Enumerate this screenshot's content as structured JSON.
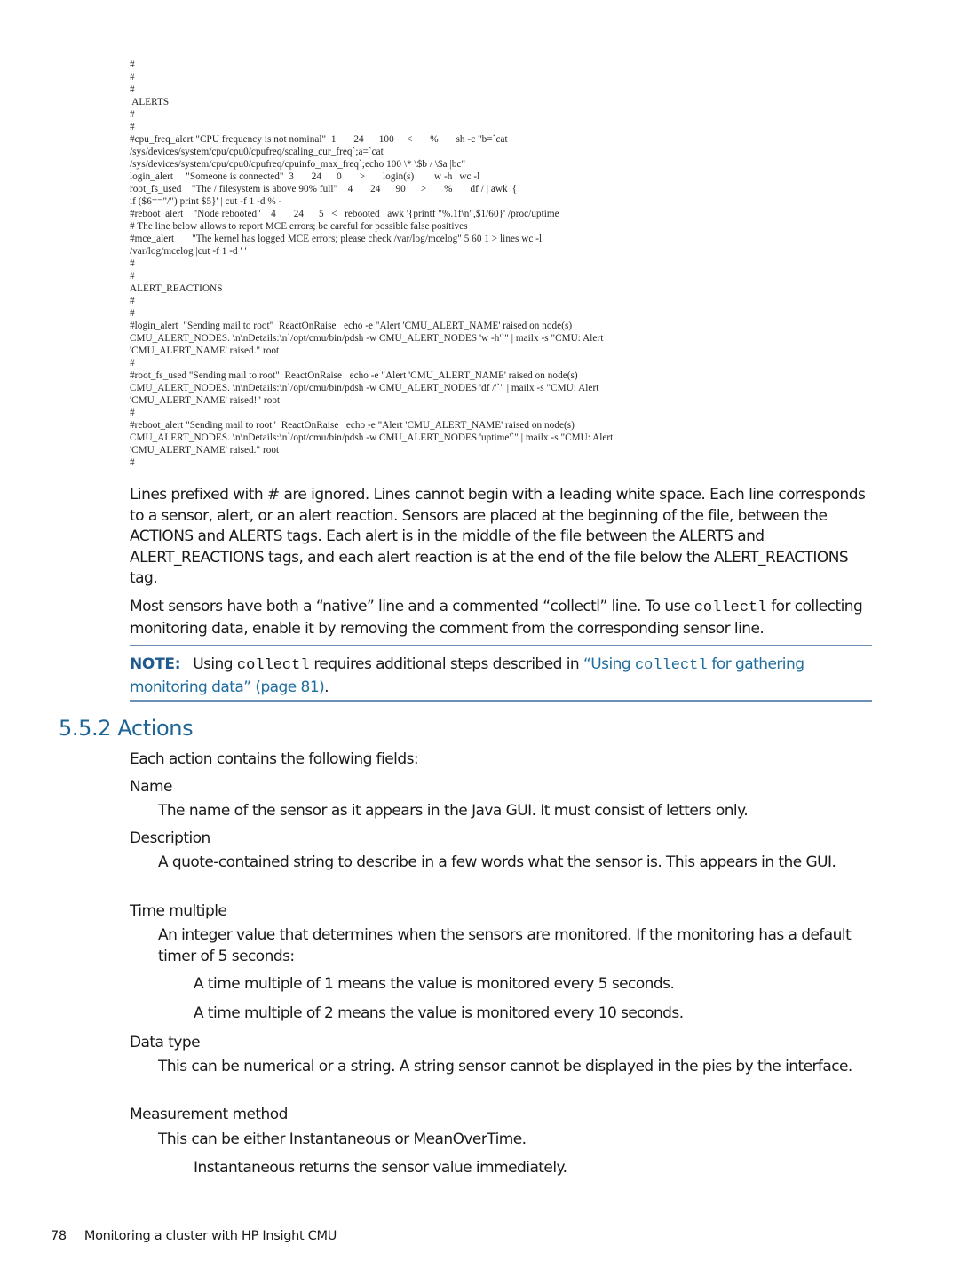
{
  "code_block": {
    "lines": [
      "#",
      "#",
      "#",
      " ALERTS",
      "#",
      "#",
      "#cpu_freq_alert \"CPU frequency is not nominal\"  1       24      100     <       %       sh -c \"b=`cat",
      "/sys/devices/system/cpu/cpu0/cpufreq/scaling_cur_freq`;a=`cat",
      "/sys/devices/system/cpu/cpu0/cpufreq/cpuinfo_max_freq`;echo 100 \\* \\$b / \\$a |bc\"",
      "login_alert     \"Someone is connected\"  3       24      0       >       login(s)        w -h | wc -l",
      "root_fs_used    \"The / filesystem is above 90% full\"    4       24      90      >       %       df / | awk '{",
      "if ($6==\"/\") print $5}' | cut -f 1 -d % -",
      "#reboot_alert    \"Node rebooted\"    4       24      5   <   rebooted   awk '{printf \"%.1f\\n\",$1/60}' /proc/uptime",
      "# The line below allows to report MCE errors; be careful for possible false positives",
      "#mce_alert       \"The kernel has logged MCE errors; please check /var/log/mcelog\" 5 60 1 > lines wc -l",
      "/var/log/mcelog |cut -f 1 -d ' '",
      "#",
      "#",
      "ALERT_REACTIONS",
      "#",
      "#",
      "#login_alert  \"Sending mail to root\"  ReactOnRaise   echo -e \"Alert 'CMU_ALERT_NAME' raised on node(s)",
      "CMU_ALERT_NODES. \\n\\nDetails:\\n`/opt/cmu/bin/pdsh -w CMU_ALERT_NODES 'w -h'`\" | mailx -s \"CMU: Alert",
      "'CMU_ALERT_NAME' raised.\" root",
      "#",
      "#root_fs_used \"Sending mail to root\"  ReactOnRaise   echo -e \"Alert 'CMU_ALERT_NAME' raised on node(s)",
      "CMU_ALERT_NODES. \\n\\nDetails:\\n`/opt/cmu/bin/pdsh -w CMU_ALERT_NODES 'df /'`\" | mailx -s \"CMU: Alert",
      "'CMU_ALERT_NAME' raised!\" root",
      "#",
      "#reboot_alert \"Sending mail to root\"  ReactOnRaise   echo -e \"Alert 'CMU_ALERT_NAME' raised on node(s)",
      "CMU_ALERT_NODES. \\n\\nDetails:\\n`/opt/cmu/bin/pdsh -w CMU_ALERT_NODES 'uptime'`\" | mailx -s \"CMU: Alert",
      "'CMU_ALERT_NAME' raised.\" root",
      "#"
    ]
  },
  "paragraphs": {
    "p1": "Lines prefixed with # are ignored. Lines cannot begin with a leading white space. Each line corresponds to a sensor, alert, or an alert reaction. Sensors are placed at the beginning of the file, between the ACTIONS and ALERTS tags. Each alert is in the middle of the file between the ALERTS and ALERT_REACTIONS tags, and each alert reaction is at the end of the file below the ALERT_REACTIONS tag.",
    "p2_before": "Most sensors have both a “native” line and a commented “collectl” line. To use ",
    "p2_code": "collectl",
    "p2_after": " for collecting monitoring data, enable it by removing the comment from the corresponding sensor line."
  },
  "note": {
    "label": "NOTE:",
    "text_before": "Using ",
    "code": "collectl",
    "text_middle": " requires additional steps described in ",
    "link_before": "“Using ",
    "link_code": "collectl",
    "link_after": " for gathering monitoring data” (page 81)",
    "text_end": ".",
    "colors": {
      "label": "#1f5b8f",
      "link": "#1f6d9e",
      "rule": "#6b8fb5"
    }
  },
  "section": {
    "number": "5.5.2",
    "title": "Actions",
    "intro": "Each action contains the following fields:",
    "fields": [
      {
        "term": "Name",
        "definition": "The name of the sensor as it appears in the Java GUI. It must consist of letters only."
      },
      {
        "term": "Description",
        "definition": "A quote-contained string to describe in a few words what the sensor is. This appears in the GUI."
      },
      {
        "term": "Time multiple",
        "definition": "An integer value that determines when the sensors are monitored. If the monitoring has a default timer of 5 seconds:",
        "sub": [
          "A time multiple of 1 means the value is monitored every 5 seconds.",
          "A time multiple of 2 means the value is monitored every 10 seconds."
        ]
      },
      {
        "term": "Data type",
        "definition": "This can be numerical or a string. A string sensor cannot be displayed in the pies by the interface."
      },
      {
        "term": "Measurement method",
        "definition": "This can be either Instantaneous or MeanOverTime.",
        "sub": [
          "Instantaneous returns the sensor value immediately."
        ]
      }
    ]
  },
  "footer": {
    "page_number": "78",
    "chapter_title": "Monitoring a cluster with HP Insight CMU"
  }
}
